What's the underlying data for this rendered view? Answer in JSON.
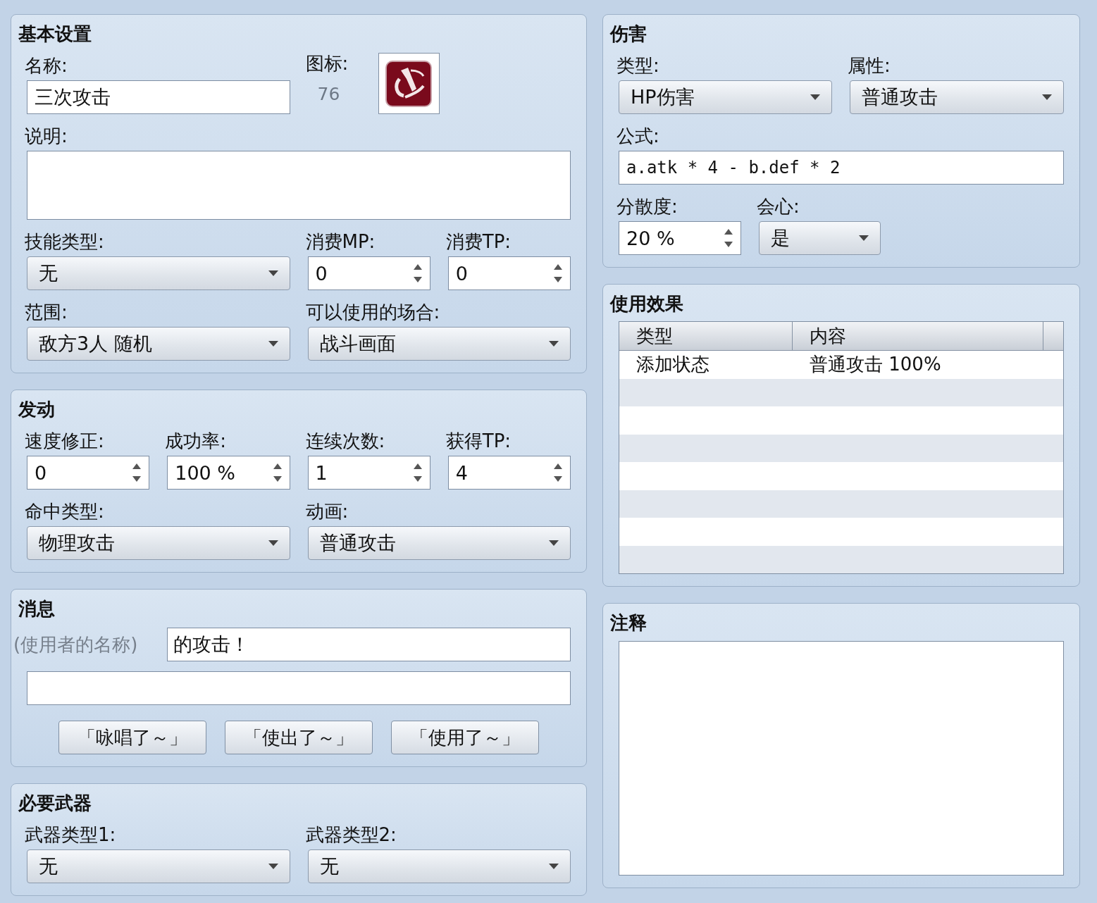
{
  "left_panels": [
    {
      "kind": "form",
      "title": "基本设置",
      "fields": [
        {
          "kind": "text",
          "label": "名称:",
          "value": "三次攻击"
        },
        {
          "kind": "icon",
          "label": "图标:",
          "number": "76"
        },
        {
          "kind": "textarea",
          "label": "说明:"
        },
        {
          "kind": "select",
          "label": "技能类型:",
          "value": "无"
        },
        {
          "kind": "spin",
          "label": "消费MP:",
          "value": "0"
        },
        {
          "kind": "spin",
          "label": "消费TP:",
          "value": "0"
        },
        {
          "kind": "select",
          "label": "范围:",
          "value": "敌方3人 随机"
        },
        {
          "kind": "select",
          "label": "可以使用的场合:",
          "value": "战斗画面"
        }
      ]
    },
    {
      "kind": "form",
      "title": "发动",
      "fields": [
        {
          "kind": "spin",
          "label": "速度修正:",
          "value": "0"
        },
        {
          "kind": "spin",
          "label": "成功率:",
          "value": "100 %"
        },
        {
          "kind": "spin",
          "label": "连续次数:",
          "value": "1"
        },
        {
          "kind": "spin",
          "label": "获得TP:",
          "value": "4"
        },
        {
          "kind": "select",
          "label": "命中类型:",
          "value": "物理攻击"
        },
        {
          "kind": "select",
          "label": "动画:",
          "value": "普通攻击"
        }
      ]
    },
    {
      "kind": "message",
      "title": "消息",
      "prefix": "(使用者的名称)",
      "line_1": "的攻击！",
      "buttons": [
        "「咏唱了～」",
        "「使出了～」",
        "「使用了～」"
      ]
    },
    {
      "kind": "form",
      "title": "必要武器",
      "fields": [
        {
          "kind": "select",
          "label": "武器类型1:",
          "value": "无"
        },
        {
          "kind": "select",
          "label": "武器类型2:",
          "value": "无"
        }
      ]
    }
  ],
  "right_panels": [
    {
      "kind": "form",
      "title": "伤害",
      "fields": [
        {
          "kind": "select",
          "label": "类型:",
          "value": "HP伤害"
        },
        {
          "kind": "select",
          "label": "属性:",
          "value": "普通攻击"
        },
        {
          "kind": "formula",
          "label": "公式:",
          "value": "a.atk * 4 - b.def * 2"
        },
        {
          "kind": "spin",
          "label": "分散度:",
          "value": "20 %"
        },
        {
          "kind": "select",
          "label": "会心:",
          "value": "是"
        }
      ]
    },
    {
      "kind": "table",
      "title": "使用效果",
      "columns": [
        "类型",
        "内容"
      ],
      "rows": [
        {
          "type": "添加状态",
          "content": "普通攻击 100%"
        }
      ]
    },
    {
      "kind": "note",
      "title": "注释"
    }
  ]
}
